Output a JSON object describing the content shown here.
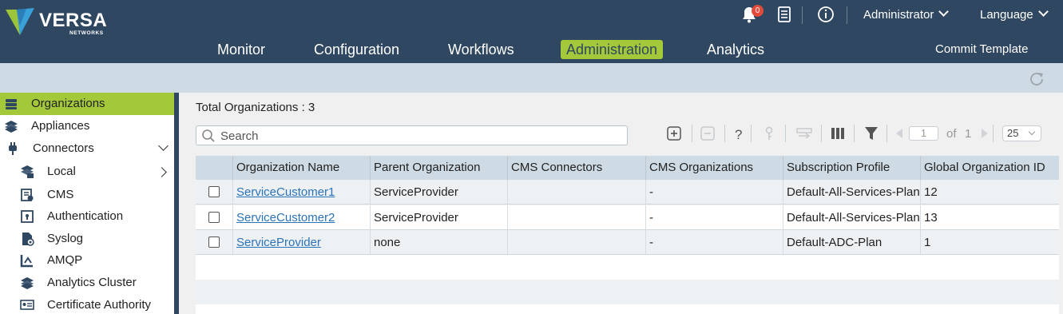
{
  "brand": {
    "name": "VERSA",
    "sub": "NETWORKS"
  },
  "header": {
    "notifications_count": "0",
    "user_menu": "Administrator",
    "language_menu": "Language"
  },
  "nav": {
    "items": [
      "Monitor",
      "Configuration",
      "Workflows",
      "Administration",
      "Analytics"
    ],
    "active": "Administration",
    "commit": "Commit Template"
  },
  "sidebar": {
    "items": [
      {
        "label": "Organizations",
        "icon": "organizations-icon",
        "active": true
      },
      {
        "label": "Appliances",
        "icon": "appliances-icon"
      },
      {
        "label": "Connectors",
        "icon": "connectors-icon",
        "expanded": true
      },
      {
        "label": "Local",
        "icon": "local-icon"
      },
      {
        "label": "CMS",
        "icon": "cms-icon"
      },
      {
        "label": "Authentication",
        "icon": "authentication-icon"
      },
      {
        "label": "Syslog",
        "icon": "syslog-icon"
      },
      {
        "label": "AMQP",
        "icon": "amqp-icon"
      },
      {
        "label": "Analytics Cluster",
        "icon": "analytics-cluster-icon"
      },
      {
        "label": "Certificate Authority",
        "icon": "certificate-authority-icon"
      }
    ]
  },
  "main": {
    "total_label": "Total Organizations",
    "total_value": ": 3",
    "search_placeholder": "Search",
    "pagination": {
      "page": "1",
      "of_label": "of",
      "total_pages": "1",
      "page_size": "25"
    }
  },
  "table": {
    "columns": [
      "Organization Name",
      "Parent Organization",
      "CMS Connectors",
      "CMS Organizations",
      "Subscription Profile",
      "Global Organization ID"
    ],
    "rows": [
      {
        "name": "ServiceCustomer1",
        "parent": "ServiceProvider",
        "cms_connectors": "",
        "cms_orgs": "-",
        "profile": "Default-All-Services-Plan",
        "global_id": "12"
      },
      {
        "name": "ServiceCustomer2",
        "parent": "ServiceProvider",
        "cms_connectors": "",
        "cms_orgs": "-",
        "profile": "Default-All-Services-Plan",
        "global_id": "13"
      },
      {
        "name": "ServiceProvider",
        "parent": "none",
        "cms_connectors": "",
        "cms_orgs": "-",
        "profile": "Default-ADC-Plan",
        "global_id": "1"
      }
    ]
  },
  "colors": {
    "header_bg": "#2f4760",
    "accent": "#a3c93a",
    "subbar_bg": "#cfdbe4",
    "link": "#2a73b8",
    "badge": "#e24b3b"
  }
}
